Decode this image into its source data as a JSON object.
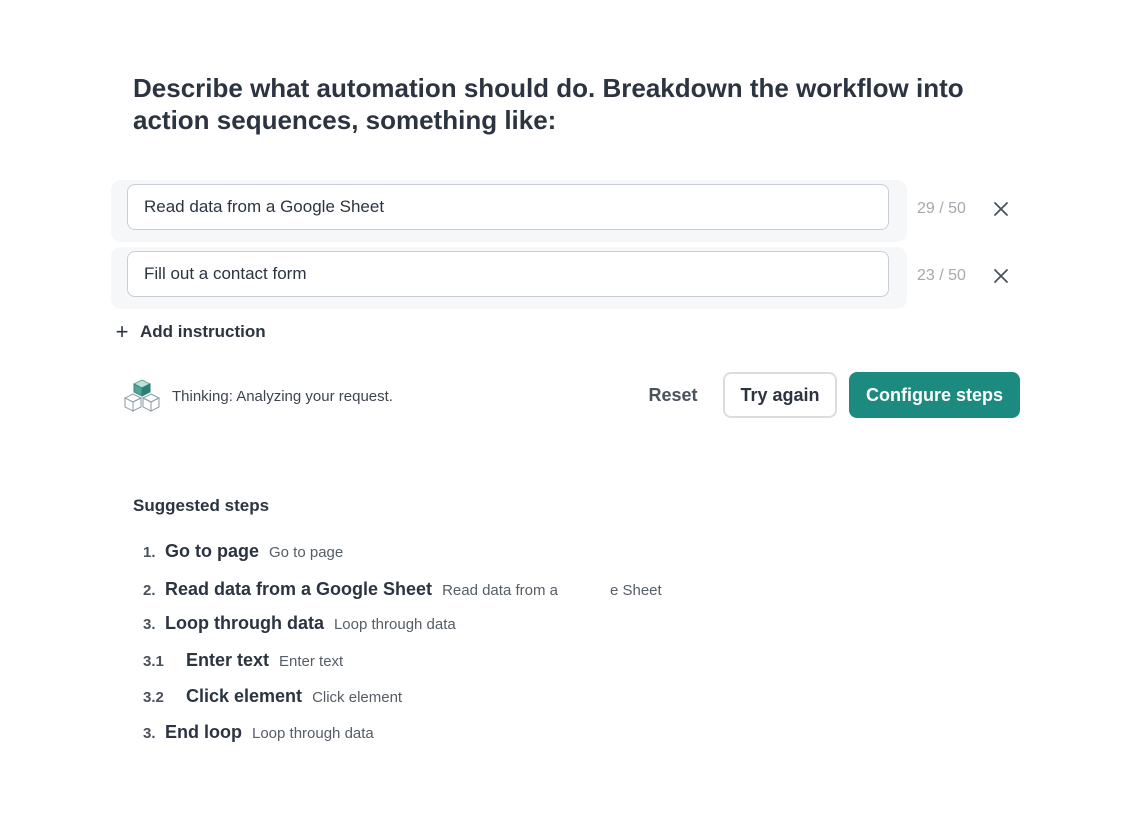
{
  "heading": "Describe what automation should do. Breakdown the workflow into action sequences, something like:",
  "instructions": [
    {
      "value": "Read data from a Google Sheet",
      "counter": "29 / 50"
    },
    {
      "value": "Fill out a contact form",
      "counter": "23 / 50"
    }
  ],
  "add_instruction": {
    "label": "Add instruction"
  },
  "thinking": {
    "text": "Thinking: Analyzing your request."
  },
  "buttons": {
    "reset": "Reset",
    "try_again": "Try again",
    "configure": "Configure steps"
  },
  "colors": {
    "accent": "#1d8a80"
  },
  "suggested": {
    "title": "Suggested steps",
    "steps": [
      {
        "num": "1.",
        "title": "Go to page",
        "desc": "Go to page"
      },
      {
        "num": "2.",
        "title": "Read data from a Google Sheet",
        "desc_start": "Read data from a",
        "desc_end": "e Sheet"
      },
      {
        "num": "3.",
        "title": "Loop through data",
        "desc": "Loop through data"
      },
      {
        "num": "3.1",
        "title": "Enter text",
        "desc": "Enter text"
      },
      {
        "num": "3.2",
        "title": "Click element",
        "desc": "Click element"
      },
      {
        "num": "3.",
        "title": "End loop",
        "desc": "Loop through data"
      }
    ]
  }
}
